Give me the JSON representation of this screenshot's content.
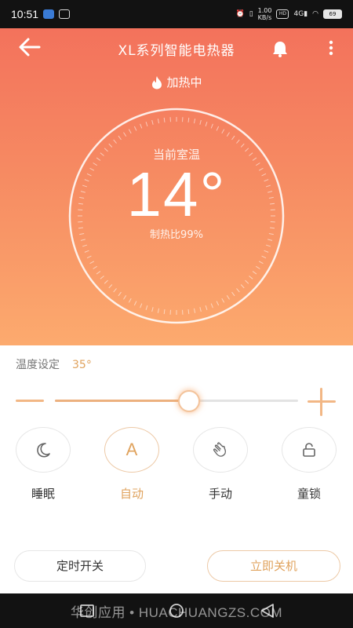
{
  "status_bar": {
    "time": "10:51",
    "network_speed": "1.00\nKB/s",
    "hd_badge": "HD",
    "signal_label": "4G",
    "battery": "69"
  },
  "header": {
    "title": "XL系列智能电热器",
    "heating_status": "加热中"
  },
  "dial": {
    "label": "当前室温",
    "temperature": "14°",
    "heat_ratio": "制热比99%"
  },
  "temperature_setting": {
    "label": "温度设定",
    "value": "35°",
    "slider_fraction": 0.55
  },
  "modes": [
    {
      "label": "睡眠",
      "icon": "moon-icon",
      "active": false
    },
    {
      "label": "自动",
      "icon": "A",
      "active": true
    },
    {
      "label": "手动",
      "icon": "hand-icon",
      "active": false
    },
    {
      "label": "童锁",
      "icon": "lock-icon",
      "active": false
    }
  ],
  "buttons": {
    "timer": "定时开关",
    "power_off": "立即关机"
  },
  "watermark": "华创应用 • HUACHUANGZS.COM",
  "colors": {
    "accent": "#e0a35e",
    "hero_top": "#f3725c",
    "hero_bottom": "#fcaa6e"
  }
}
